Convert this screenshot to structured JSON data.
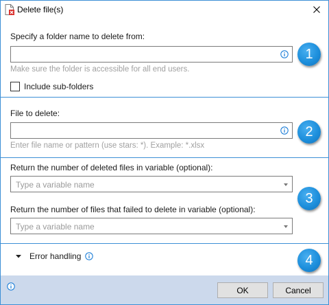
{
  "window": {
    "title": "Delete file(s)"
  },
  "section1": {
    "folder_label": "Specify a folder name to delete from:",
    "folder_value": "",
    "folder_hint": "Make sure the folder is accessible for all end users.",
    "subfolders_label": "Include sub-folders",
    "subfolders_checked": false,
    "step": "1"
  },
  "section2": {
    "file_label": "File to delete:",
    "file_value": "",
    "file_hint": "Enter file name or pattern (use stars: *).  Example: *.xlsx",
    "step": "2"
  },
  "section3": {
    "deleted_label": "Return the number of deleted files in variable (optional):",
    "deleted_placeholder": "Type a variable name",
    "failed_label": "Return the number of files that failed to delete in variable (optional):",
    "failed_placeholder": "Type a variable name",
    "step": "3"
  },
  "section4": {
    "error_label": "Error handling",
    "step": "4"
  },
  "footer": {
    "ok_label": "OK",
    "cancel_label": "Cancel"
  },
  "colors": {
    "accent": "#3c8fd6",
    "badge": "#1d8fdc",
    "footer_bg": "#ccd9ec",
    "info": "#1e7fd8"
  }
}
